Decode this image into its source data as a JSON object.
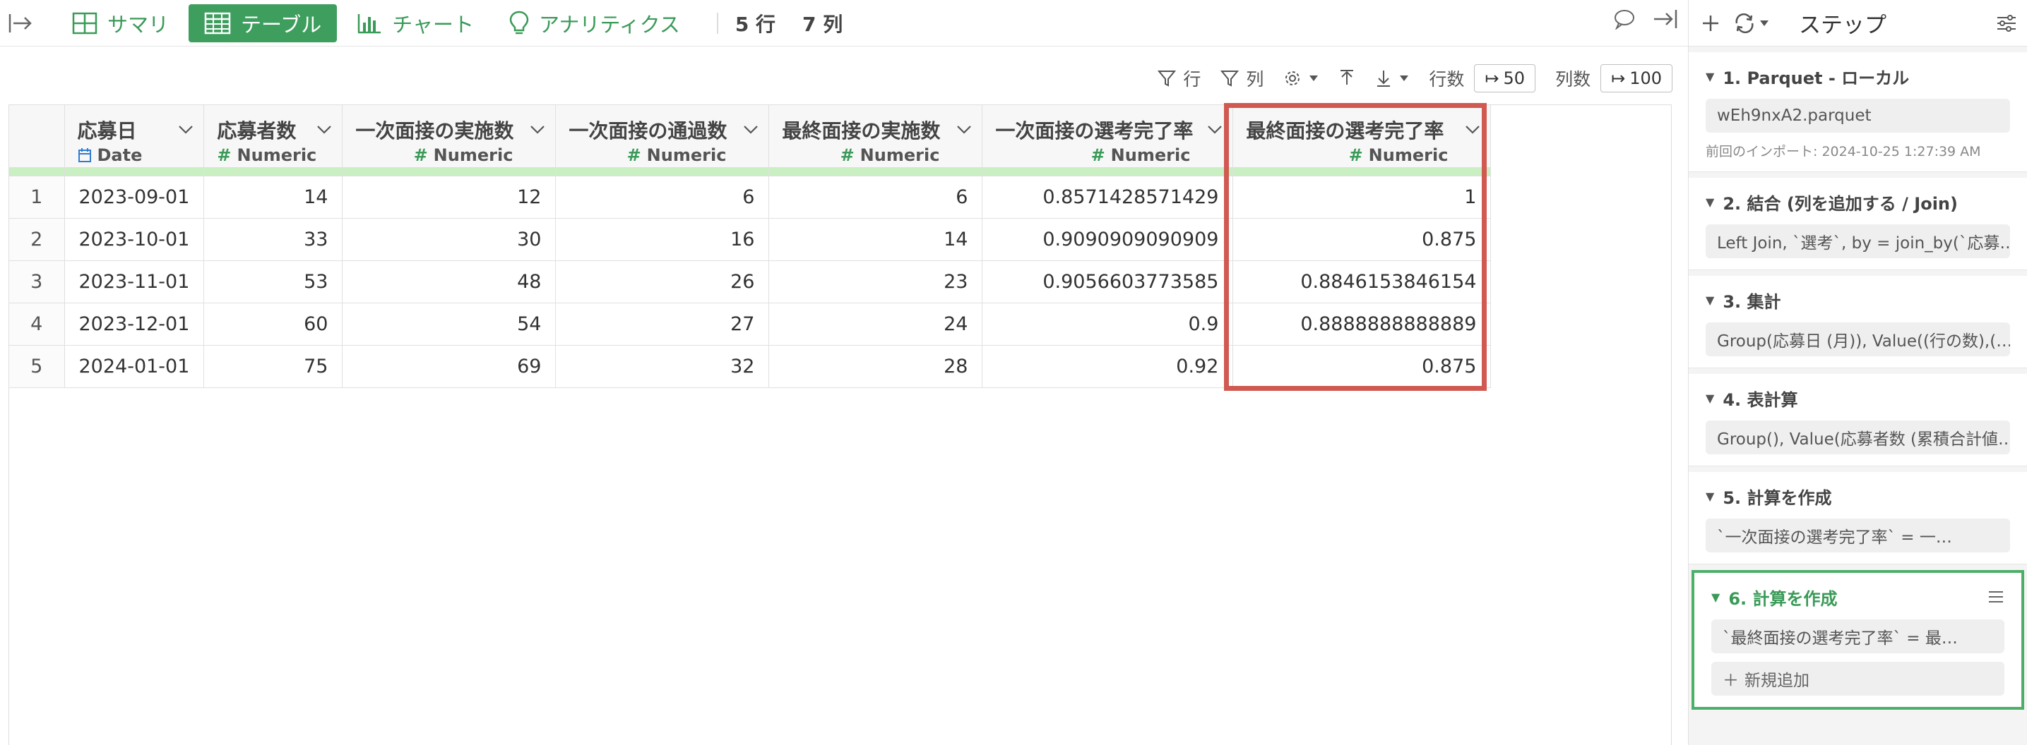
{
  "toolbar": {
    "tabs": [
      {
        "label": "サマリ",
        "icon": "summary-grid-icon"
      },
      {
        "label": "テーブル",
        "icon": "table-icon",
        "active": true
      },
      {
        "label": "チャート",
        "icon": "bar-chart-icon"
      },
      {
        "label": "アナリティクス",
        "icon": "lightbulb-icon"
      }
    ],
    "row_count": "5 行",
    "col_count": "7 列",
    "accent_color": "#3e9e5e"
  },
  "subbar": {
    "row_filter": "行",
    "col_filter": "列",
    "rows_label": "行数",
    "rows_value": "50",
    "cols_label": "列数",
    "cols_value": "100"
  },
  "table": {
    "columns": [
      {
        "name": "応募日",
        "type": "Date"
      },
      {
        "name": "応募者数",
        "type": "Numeric"
      },
      {
        "name": "一次面接の実施数",
        "type": "Numeric"
      },
      {
        "name": "一次面接の通過数",
        "type": "Numeric"
      },
      {
        "name": "最終面接の実施数",
        "type": "Numeric"
      },
      {
        "name": "一次面接の選考完了率",
        "type": "Numeric"
      },
      {
        "name": "最終面接の選考完了率",
        "type": "Numeric"
      }
    ],
    "rows": [
      {
        "idx": "1",
        "cells": [
          "2023-09-01",
          "14",
          "12",
          "6",
          "6",
          "0.8571428571429",
          "1"
        ]
      },
      {
        "idx": "2",
        "cells": [
          "2023-10-01",
          "33",
          "30",
          "16",
          "14",
          "0.9090909090909",
          "0.875"
        ]
      },
      {
        "idx": "3",
        "cells": [
          "2023-11-01",
          "53",
          "48",
          "26",
          "23",
          "0.9056603773585",
          "0.8846153846154"
        ]
      },
      {
        "idx": "4",
        "cells": [
          "2023-12-01",
          "60",
          "54",
          "27",
          "24",
          "0.9",
          "0.8888888888889"
        ]
      },
      {
        "idx": "5",
        "cells": [
          "2024-01-01",
          "75",
          "69",
          "32",
          "28",
          "0.92",
          "0.875"
        ]
      }
    ],
    "highlight_color": "#d05a52"
  },
  "panel": {
    "title": "ステップ",
    "steps": [
      {
        "title": "1. Parquet - ローカル",
        "body": "wEh9nxA2.parquet",
        "sub": "前回のインポート: 2024-10-25 1:27:39 AM"
      },
      {
        "title": "2. 結合 (列を追加する / Join)",
        "body": "Left Join, `選考`, by = join_by(`応募…"
      },
      {
        "title": "3. 集計",
        "body": "Group(応募日 (月)), Value((行の数),(…"
      },
      {
        "title": "4. 表計算",
        "body": "Group(), Value(応募者数 (累積合計値…"
      },
      {
        "title": "5. 計算を作成",
        "body": "`一次面接の選考完了率` = 一…"
      },
      {
        "title": "6. 計算を作成",
        "body": "`最終面接の選考完了率` = 最…",
        "active": true
      }
    ],
    "add_new": "新規追加"
  }
}
